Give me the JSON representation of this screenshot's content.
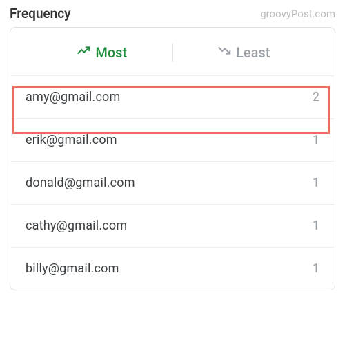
{
  "header": {
    "title": "Frequency",
    "watermark": "groovyPost.com"
  },
  "tabs": {
    "most_label": "Most",
    "least_label": "Least"
  },
  "rows": [
    {
      "email": "amy@gmail.com",
      "count": "2"
    },
    {
      "email": "erik@gmail.com",
      "count": "1"
    },
    {
      "email": "donald@gmail.com",
      "count": "1"
    },
    {
      "email": "cathy@gmail.com",
      "count": "1"
    },
    {
      "email": "billy@gmail.com",
      "count": "1"
    }
  ],
  "highlight": {
    "top": "124",
    "left": "18",
    "width": "460",
    "height": "70"
  }
}
